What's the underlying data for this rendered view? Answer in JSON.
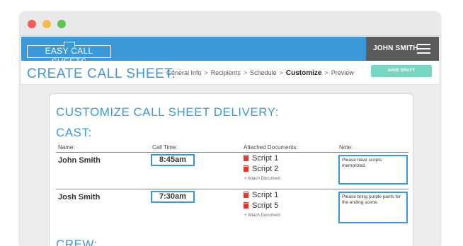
{
  "app": {
    "logo_text": "EASY CALL SHEETS",
    "user_name": "JOHN SMITH",
    "colors": {
      "brand_blue": "#3b99d9",
      "user_gray": "#5b5b5b",
      "save_green": "#79d6c3"
    }
  },
  "header": {
    "title": "CREATE CALL SHEET:",
    "steps": [
      {
        "label": "General Info",
        "active": false
      },
      {
        "label": "Recipients",
        "active": false
      },
      {
        "label": "Schedule",
        "active": false
      },
      {
        "label": "Customize",
        "active": true
      },
      {
        "label": "Preview",
        "active": false
      }
    ],
    "step_separator": ">",
    "save_draft_label": "SAVE DRAFT"
  },
  "main": {
    "section_title": "CUSTOMIZE CALL SHEET DELIVERY:",
    "cast_title": "CAST:",
    "crew_title": "CREW:",
    "columns": {
      "name": "Name:",
      "call_time": "Call Time:",
      "documents": "Attached Documents:",
      "note": "Note:"
    },
    "attach_label": "+ Attach Document",
    "cast": [
      {
        "name": "John Smith",
        "call_time": "8:45am",
        "documents": [
          "Script 1",
          "Script 2"
        ],
        "note": "Please have scripts memorized."
      },
      {
        "name": "Josh Smith",
        "call_time": "7:30am",
        "documents": [
          "Script 1",
          "Script 5"
        ],
        "note": "Please bring purple pants for the ending scene."
      }
    ]
  }
}
